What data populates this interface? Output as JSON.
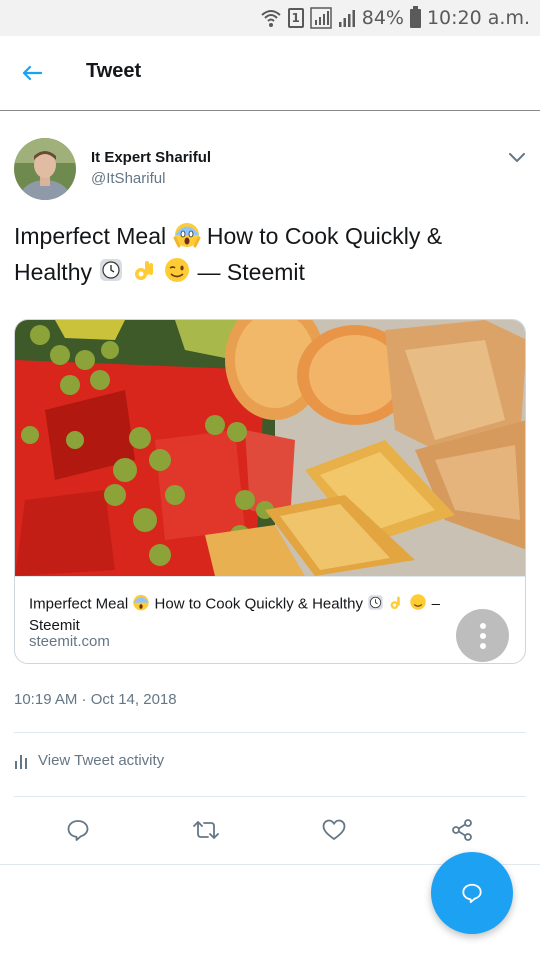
{
  "status_bar": {
    "battery_percent": "84%",
    "time": "10:20 a.m.",
    "sim_label": "1",
    "icons": [
      "wifi-icon",
      "sim-icon",
      "signal-icon",
      "signal-icon",
      "battery-icon"
    ]
  },
  "header": {
    "title": "Tweet",
    "back_icon": "arrow-left-icon"
  },
  "tweet": {
    "author_name": "It Expert Shariful",
    "author_handle": "@ItShariful",
    "text_part1": "Imperfect Meal",
    "text_part2": "How to Cook Quickly &",
    "text_part3": "Healthy",
    "text_part4": "— Steemit",
    "timestamp": "10:19 AM · Oct 14, 2018",
    "emojis": [
      "screaming-face-emoji",
      "clock-emoji",
      "ok-hand-emoji",
      "winking-face-emoji"
    ]
  },
  "card": {
    "title_part1": "Imperfect Meal",
    "title_part2": "How to Cook Quickly & Healthy",
    "title_part3": "–",
    "title_part4": "Steemit",
    "domain": "steemit.com"
  },
  "activity": {
    "label": "View Tweet activity"
  },
  "actions": [
    "reply-icon",
    "retweet-icon",
    "like-icon",
    "share-icon"
  ],
  "colors": {
    "accent": "#1da1f2",
    "text_primary": "#14171a",
    "text_secondary": "#657786",
    "border": "#e1e8ed"
  }
}
